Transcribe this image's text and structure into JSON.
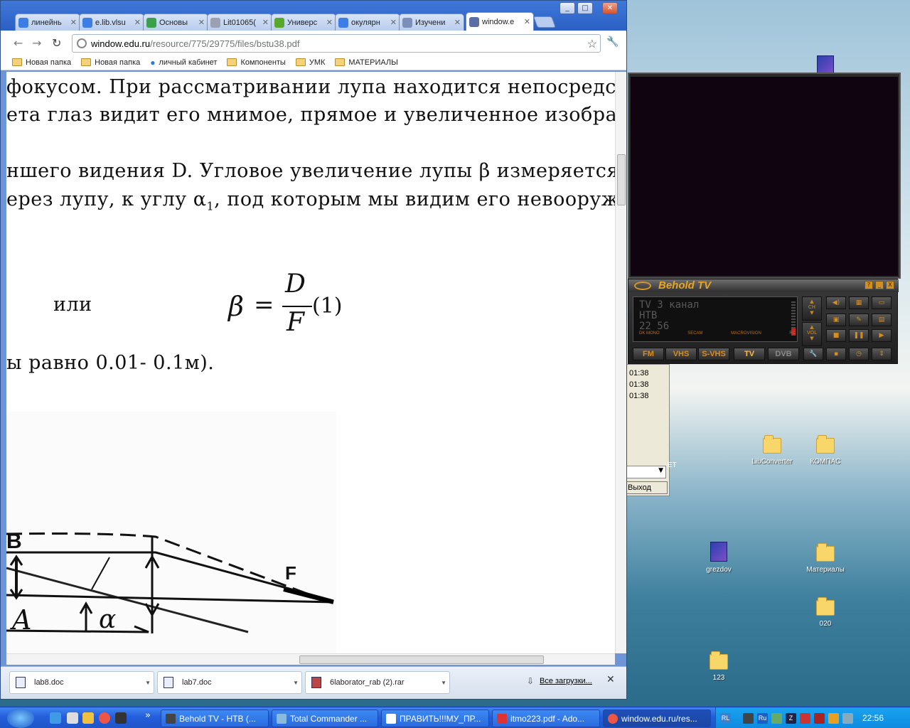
{
  "browser": {
    "tabs": [
      {
        "label": "линейнь",
        "color": "#3d7ee6"
      },
      {
        "label": "e.lib.vlsu",
        "color": "#3d7ee6"
      },
      {
        "label": "Основы",
        "color": "#3aa14a"
      },
      {
        "label": "Lit01065(",
        "color": "#9aa2b2"
      },
      {
        "label": "Универс",
        "color": "#58a82b"
      },
      {
        "label": "окулярн",
        "color": "#3d7ee6"
      },
      {
        "label": "Изучени",
        "color": "#7b8fb8"
      },
      {
        "label": "window.e",
        "color": "#5b6ea8"
      }
    ],
    "address": {
      "host": "window.edu.ru",
      "path": "/resource/775/29775/files/bstu38.pdf"
    },
    "bookmarks": [
      "Новая папка",
      "Новая папка",
      "личный кабинет",
      "Компоненты",
      "УМК",
      "МАТЕРИАЛЫ"
    ],
    "window_buttons": [
      "_",
      "□",
      "✕"
    ]
  },
  "document": {
    "line1": "фокусом. При рассматривании лупа находится непосредст",
    "line2": "ета глаз видит его мнимое, прямое и увеличенное изображ",
    "line3": "ншего видения D. Угловое увеличение лупы β  измеряется",
    "line4_a": "ерез лупу, к углу α",
    "line4_sub": "1",
    "line4_b": ", под которым мы видим его невооруже",
    "ili": "или",
    "formula": {
      "lhs": "β",
      "eq": "=",
      "num": "D",
      "den": "F",
      "tag": "(1)"
    },
    "line6": "ы равно 0.01- 0.1м).",
    "diagram": {
      "B": "B",
      "F": "F",
      "A": "A",
      "alpha": "α"
    }
  },
  "downloads": {
    "items": [
      "lab8.doc",
      "lab7.doc",
      "6laborator_rab (2).rar"
    ],
    "all": "Все загрузки..."
  },
  "behold": {
    "title": "Behold TV",
    "lcd": [
      "TV 3 канал",
      "НТВ",
      "22 56"
    ],
    "flags": [
      "DK MONO",
      "SECAM",
      "MACROVISION",
      "RC"
    ],
    "modes": [
      "FM",
      "VHS",
      "S-VHS",
      "TV",
      "DVB"
    ],
    "ch": "CH",
    "vol": "VOL",
    "title_buttons": [
      "?",
      "_",
      "X"
    ]
  },
  "commander": {
    "rows": [
      "01:38",
      "01:38",
      "01:38"
    ],
    "exit": "Выход",
    "fragment": "ET"
  },
  "desktop": {
    "icons": [
      {
        "label": "LibConverter",
        "type": "folder"
      },
      {
        "label": "КОМПАС",
        "type": "folder"
      },
      {
        "label": "grezdov",
        "type": "doc"
      },
      {
        "label": "Материалы",
        "type": "folder"
      },
      {
        "label": "020",
        "type": "folder"
      },
      {
        "label": "123",
        "type": "folder"
      }
    ]
  },
  "taskbar": {
    "tasks": [
      "Behold TV - НТВ (...",
      "Total Commander ...",
      "ПРАВИТЬ!!!МУ_ПР...",
      "itmo223.pdf - Ado...",
      "window.edu.ru/res..."
    ],
    "lang": "Ru",
    "rl": "RL",
    "clock": "22:56",
    "chevron": "»"
  }
}
